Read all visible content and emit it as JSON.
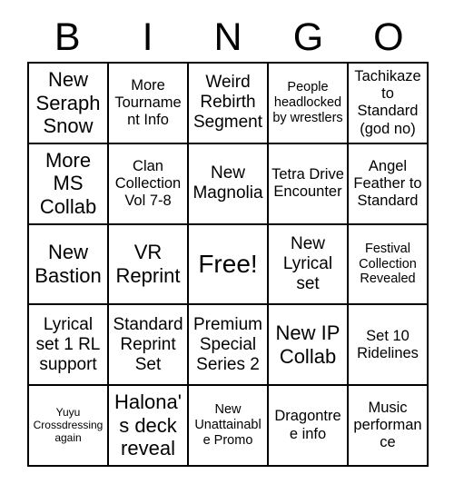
{
  "card": {
    "title_letters": [
      "B",
      "I",
      "N",
      "G",
      "O"
    ],
    "free_space_label": "Free!",
    "colors": {
      "background": "#ffffff",
      "border": "#000000",
      "text": "#000000"
    },
    "rows": [
      [
        {
          "text": "New Seraph Snow",
          "size": "xl"
        },
        {
          "text": "More Tournament Info",
          "size": "md"
        },
        {
          "text": "Weird Rebirth Segment",
          "size": "lg"
        },
        {
          "text": "People headlocked by wrestlers",
          "size": "sm"
        },
        {
          "text": "Tachikaze to Standard (god no)",
          "size": "md"
        }
      ],
      [
        {
          "text": "More MS Collab",
          "size": "xl"
        },
        {
          "text": "Clan Collection Vol 7-8",
          "size": "md"
        },
        {
          "text": "New Magnolia",
          "size": "lg"
        },
        {
          "text": "Tetra Drive Encounter",
          "size": "md"
        },
        {
          "text": "Angel Feather to Standard",
          "size": "md"
        }
      ],
      [
        {
          "text": "New Bastion",
          "size": "xl"
        },
        {
          "text": "VR Reprint",
          "size": "xl"
        },
        {
          "text": "Free!",
          "size": "free"
        },
        {
          "text": "New Lyrical set",
          "size": "lg"
        },
        {
          "text": "Festival Collection Revealed",
          "size": "sm"
        }
      ],
      [
        {
          "text": "Lyrical set 1 RL support",
          "size": "lg"
        },
        {
          "text": "Standard Reprint Set",
          "size": "lg"
        },
        {
          "text": "Premium Special Series 2",
          "size": "lg"
        },
        {
          "text": "New IP Collab",
          "size": "xl"
        },
        {
          "text": "Set 10 Ridelines",
          "size": "md"
        }
      ],
      [
        {
          "text": "Yuyu Crossdressing again",
          "size": "xs"
        },
        {
          "text": "Halona's deck reveal",
          "size": "xl"
        },
        {
          "text": "New Unattainable Promo",
          "size": "sm"
        },
        {
          "text": "Dragontree info",
          "size": "md"
        },
        {
          "text": "Music performance",
          "size": "md"
        }
      ]
    ]
  }
}
